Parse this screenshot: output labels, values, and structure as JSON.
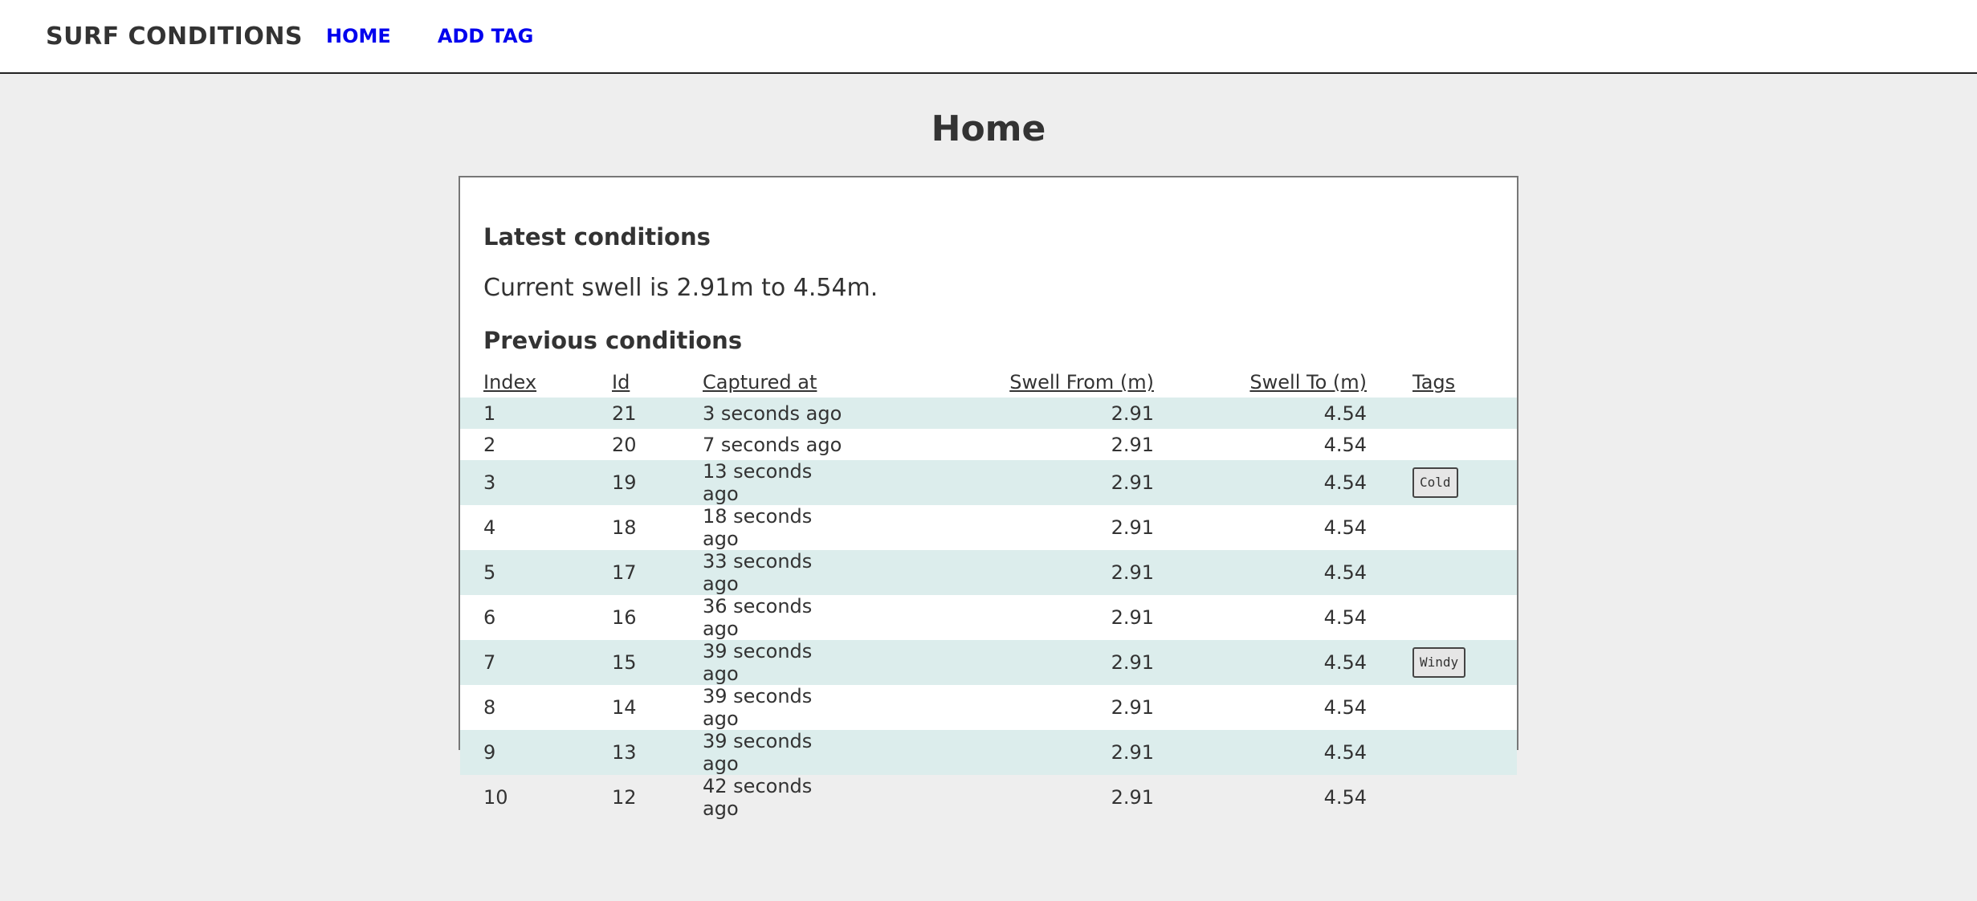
{
  "header": {
    "brand": "SURF CONDITIONS",
    "nav": [
      {
        "label": "HOME"
      },
      {
        "label": "ADD TAG"
      }
    ]
  },
  "page_title": "Home",
  "latest": {
    "heading": "Latest conditions",
    "text": "Current swell is 2.91m to 4.54m."
  },
  "previous": {
    "heading": "Previous conditions",
    "columns": [
      "Index",
      "Id",
      "Captured at",
      "Swell From (m)",
      "Swell To (m)",
      "Tags"
    ],
    "rows": [
      {
        "index": "1",
        "id": "21",
        "captured_at": "3 seconds ago",
        "swell_from": "2.91",
        "swell_to": "4.54",
        "tag": ""
      },
      {
        "index": "2",
        "id": "20",
        "captured_at": "7 seconds ago",
        "swell_from": "2.91",
        "swell_to": "4.54",
        "tag": ""
      },
      {
        "index": "3",
        "id": "19",
        "captured_at": "13 seconds ago",
        "swell_from": "2.91",
        "swell_to": "4.54",
        "tag": "Cold"
      },
      {
        "index": "4",
        "id": "18",
        "captured_at": "18 seconds ago",
        "swell_from": "2.91",
        "swell_to": "4.54",
        "tag": ""
      },
      {
        "index": "5",
        "id": "17",
        "captured_at": "33 seconds ago",
        "swell_from": "2.91",
        "swell_to": "4.54",
        "tag": ""
      },
      {
        "index": "6",
        "id": "16",
        "captured_at": "36 seconds ago",
        "swell_from": "2.91",
        "swell_to": "4.54",
        "tag": ""
      },
      {
        "index": "7",
        "id": "15",
        "captured_at": "39 seconds ago",
        "swell_from": "2.91",
        "swell_to": "4.54",
        "tag": "Windy"
      },
      {
        "index": "8",
        "id": "14",
        "captured_at": "39 seconds ago",
        "swell_from": "2.91",
        "swell_to": "4.54",
        "tag": ""
      },
      {
        "index": "9",
        "id": "13",
        "captured_at": "39 seconds ago",
        "swell_from": "2.91",
        "swell_to": "4.54",
        "tag": ""
      },
      {
        "index": "10",
        "id": "12",
        "captured_at": "42 seconds ago",
        "swell_from": "2.91",
        "swell_to": "4.54",
        "tag": ""
      }
    ]
  },
  "colors": {
    "page_background": "#eeeeee",
    "link": "#0000ee",
    "row_stripe": "#dcedec",
    "text": "#333333"
  }
}
